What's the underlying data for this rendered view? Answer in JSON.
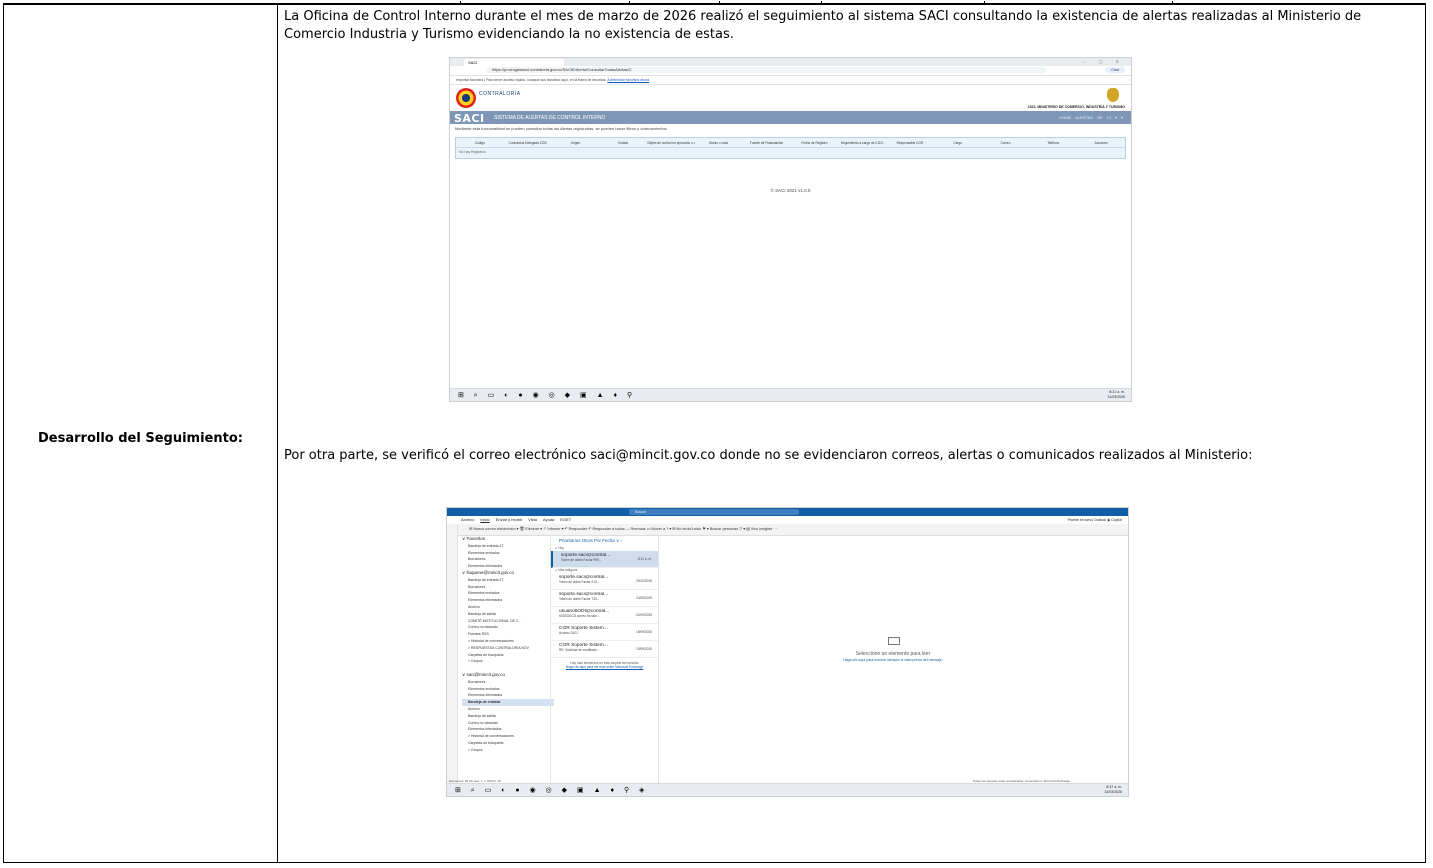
{
  "row_label": "Desarrollo del Seguimiento:",
  "paragraph_1": "La Oficina de Control Interno durante el mes de marzo de 2026 realizó el seguimiento al sistema SACI consultando la existencia de alertas realizadas al Ministerio de Comercio Industria y Turismo evidenciando la no existencia de estas.",
  "paragraph_2": "Por otra parte, se verificó el correo electrónico saci@mincit.gov.co donde no se evidenciaron correos, alertas o comunicados realizados al Ministerio:",
  "screenshot_1": {
    "tab_title": "SACI",
    "window_controls": "– ▢ ✕",
    "url": "https://prorrogasinsci.contraloria.gov.co/SACIE/Alerta/ConsultarTodasAlertasCI",
    "copilot": "Chat",
    "favorites_bar": "Importar favoritos   |   Para tener acceso rápido, coloque sus favoritos aquí, en la barra de favoritos.",
    "favorites_link": "Administrar favoritos ahora",
    "logo_text": "CONTRALORÍA",
    "entity": "2323. MINISTERIO DE COMERCIO, INDUSTRIA Y TURISMO",
    "brand": "SACI",
    "system_name": "SISTEMA DE ALERTAS DE CONTROL INTERNO",
    "nav": "HOME   ALERTAS DE CI ▾   ▾",
    "description": "Mediante esta funcionalidad se pueden consultar todas las Alertas registradas, se pueden hacer filtros y ordenamientos.",
    "columns": [
      "Código",
      "Contraloría Delegada CGR",
      "Origen",
      "Estado",
      "Objeto de control en ejecución o desarrollo",
      "Monto o valor",
      "Fuente de Financiación",
      "Fecha de Registro",
      "Seguimiento a cargo de CGCI",
      "Responsable CGR",
      "Cargo",
      "Correo",
      "Teléfono",
      "Acciones"
    ],
    "no_records": "No hay Registros",
    "footer": "© SACI 2021 v1.0.0",
    "taskbar_icons": "⊞ ⌕ ▭ ◐ ● ◉ ◎ ◆ ▣ ▲ ♦ ⚲",
    "clock_time": "8:21 a. m.",
    "clock_date": "31/03/2026"
  },
  "screenshot_2": {
    "search": "Buscar",
    "menu": [
      "Archivo",
      "Inicio",
      "Enviar y recibir",
      "Vista",
      "Ayuda",
      "EGET"
    ],
    "menu_right": "Pruebe el nuevo Outlook   ◉ Copilot",
    "ribbon": "✉ Nuevo correo electrónico ▾   🗑 Eliminar ▾   ⚐ Informe ▾   ↶ Responder   ↶ Responder a todos   → Reenviar   ▭ Mover a ? ▾   ✉ No leído/Leído   ⚑ ▾   Buscar personas   ▽ ▾   ▤ Vivo insights ⋯",
    "folders": [
      {
        "t": "∨ Favoritos",
        "c": "grp"
      },
      {
        "t": "Bandeja de entrada    27",
        "c": ""
      },
      {
        "t": "Elementos enviados",
        "c": ""
      },
      {
        "t": "Borradores",
        "c": ""
      },
      {
        "t": "Elementos eliminados",
        "c": ""
      },
      {
        "t": "∨ lluquene@mincit.gov.co",
        "c": "grp"
      },
      {
        "t": "Bandeja de entrada    27",
        "c": ""
      },
      {
        "t": "Borradores",
        "c": ""
      },
      {
        "t": "Elementos enviados",
        "c": ""
      },
      {
        "t": "Elementos eliminados",
        "c": ""
      },
      {
        "t": "Archivo",
        "c": ""
      },
      {
        "t": "Bandeja de salida",
        "c": ""
      },
      {
        "t": "COMITÉ INSTITUCIONAL DE C...",
        "c": ""
      },
      {
        "t": "Correo no deseado",
        "c": ""
      },
      {
        "t": "Fuentes RSS",
        "c": ""
      },
      {
        "t": "> Historial de conversaciones",
        "c": ""
      },
      {
        "t": "> RESPUESTAS CONTRALORIA NOV",
        "c": ""
      },
      {
        "t": "Carpetas de búsqueda",
        "c": ""
      },
      {
        "t": "> Grupos",
        "c": ""
      },
      {
        "t": "",
        "c": ""
      },
      {
        "t": "∨ saci@mincit.gov.co",
        "c": "grp"
      },
      {
        "t": "Borradores",
        "c": ""
      },
      {
        "t": "Elementos enviados",
        "c": ""
      },
      {
        "t": "Elementos eliminados",
        "c": ""
      },
      {
        "t": "Bandeja de entrada",
        "c": "sel"
      },
      {
        "t": "Archivo",
        "c": ""
      },
      {
        "t": "Bandeja de salida",
        "c": ""
      },
      {
        "t": "Correo no deseado",
        "c": ""
      },
      {
        "t": "Elementos infectados",
        "c": ""
      },
      {
        "t": "> Historial de conversaciones",
        "c": ""
      },
      {
        "t": "Carpetas de búsqueda",
        "c": ""
      },
      {
        "t": "> Grupos",
        "c": ""
      }
    ],
    "list_tabs": "Prioritarios   Otros   Por Fecha ∨  ↑",
    "group_today": "∨ Hoy",
    "group_older": "∨ Más antiguos",
    "messages": [
      {
        "sender": "soporte.saci@contral...",
        "subject": "Token de doble Factor 999...",
        "date": "8:11 a. m.",
        "sel": true
      },
      {
        "sender": "soporte.saci@contral...",
        "subject": "Token de doble Factor 213...",
        "date": "29/12/2025",
        "sel": false
      },
      {
        "sender": "soporte.saci@contral...",
        "subject": "Token de doble Factor 733...",
        "date": "24/09/2025",
        "sel": false
      },
      {
        "sender": "usuario5ODI@contral...",
        "subject": "SIGEDOCD correo ha sido ...",
        "date": "22/09/2025",
        "sel": false
      },
      {
        "sender": "CGR Soporte Sistem...",
        "subject": "Acceso SACI",
        "date": "19/09/2025",
        "sel": false
      },
      {
        "sender": "CGR Soporte Sistem...",
        "subject": "RE: Solicitud de modificaci...",
        "date": "19/09/2025",
        "sel": false
      }
    ],
    "more_info": "Hay más elementos en esta carpeta del servidor",
    "more_link": "Haga clic aquí para ver más sobre Microsoft Exchange",
    "reading_title": "Seleccione un elemento para leer",
    "reading_hint": "Haga clic aquí para mostrar siempre la vista previa del mensaje.",
    "status_left": "Elementos: 25   Sin leer: 1   ⚠ AVISO: 18",
    "status_right": "Todas las carpetas están actualizadas.   Conectado a: Microsoft Exchange",
    "taskbar_icons": "⊞ ⌕ ▭ ◐ ● ◉ ◎ ◆ ▣ ▲ ♦ ⚲ ◈",
    "clock_time": "8:37 a. m.",
    "clock_date": "31/03/2026"
  }
}
